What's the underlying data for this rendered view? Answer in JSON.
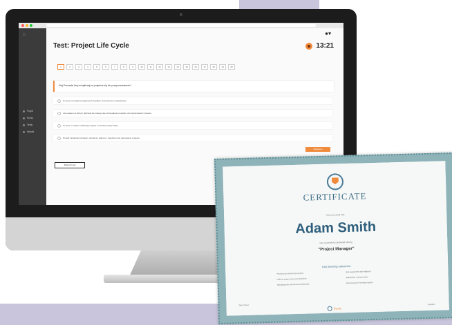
{
  "app": {
    "test_title": "Test: Project Life Cycle",
    "timer": "13:21",
    "question_numbers": [
      "1",
      "2",
      "3",
      "4",
      "5",
      "6",
      "7",
      "8",
      "9",
      "10",
      "11",
      "12",
      "13",
      "14",
      "15",
      "16",
      "17",
      "18",
      "19",
      "20"
    ],
    "question_text": "Kiej Prowadzi fazy inicjalizacji w projekcie się ich przeprowadzenie?",
    "options": [
      "To jedna od zadań projektowych zwykłym scenariuszem projektowym.",
      "Jest etapem w którym definiuje się zasięg cele szczegółowe projektu oraz wykonawców projektu.",
      "To jeden z etapów realizacji projektu i pozwala przejść dalej.",
      "Projekt inicjalizacji strategii, określenie zakresu i zasobów oraz planowanie projektu."
    ],
    "next_label": "Następne",
    "finish_label": "Zakończ test",
    "sidebar_items": [
      "Pulpit",
      "Kursy",
      "Testy",
      "Wyniki"
    ],
    "user_icon": "user-icon",
    "timer_icon": "clock-icon"
  },
  "certificate": {
    "title": "CERTIFICATE",
    "subtitle": "This is to certify that:",
    "name": "Adam Smith",
    "completion_text": "has successfully completed training",
    "role": "\"Project Manager\"",
    "skills_heading": "Key learning outcomes:",
    "skills_left": [
      "Planning and structuring a project",
      "Defining project scope and objectives",
      "Managing time and resources effectively"
    ],
    "skills_right": [
      "Risk assessment and mitigation",
      "Stakeholder communication",
      "Monitoring and reporting progress"
    ],
    "brand": "Stanly",
    "footer_left": "Date of issue",
    "footer_right": "Signature"
  },
  "colors": {
    "accent": "#f08a3c",
    "sidebar": "#3b3b3b",
    "certificate_border": "#8eb3b8",
    "certificate_text": "#2f5f7c"
  }
}
